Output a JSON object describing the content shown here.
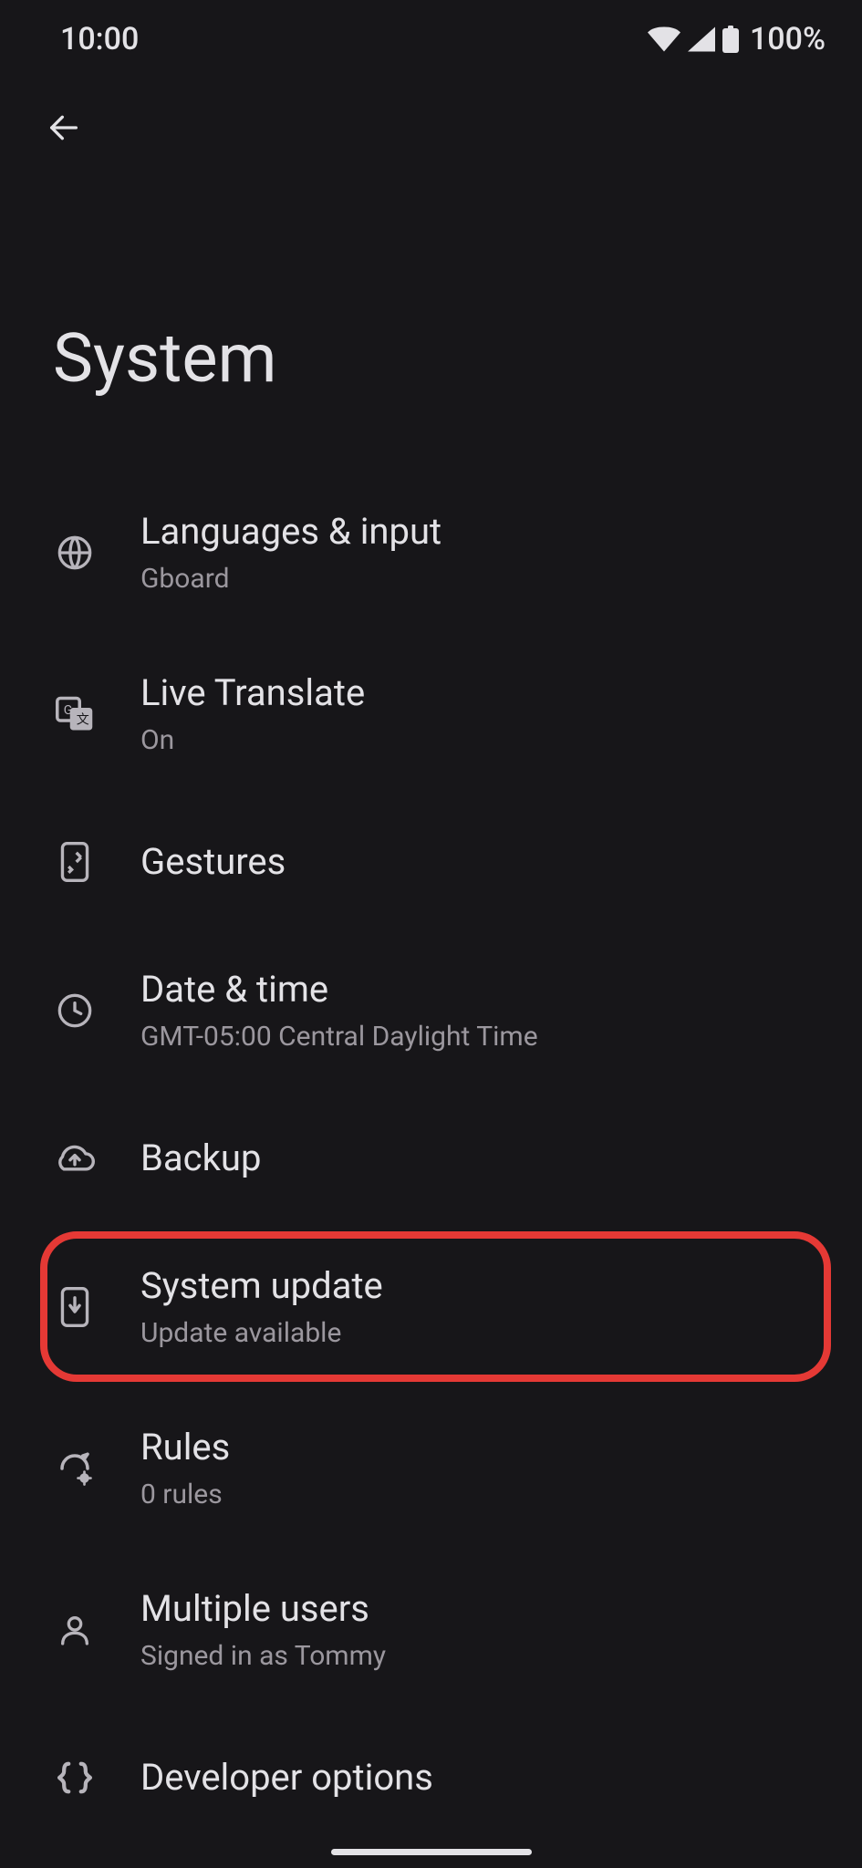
{
  "status": {
    "time": "10:00",
    "battery": "100%"
  },
  "page": {
    "title": "System"
  },
  "items": [
    {
      "icon": "globe",
      "title": "Languages & input",
      "subtitle": "Gboard"
    },
    {
      "icon": "translate",
      "title": "Live Translate",
      "subtitle": "On"
    },
    {
      "icon": "gestures",
      "title": "Gestures",
      "subtitle": ""
    },
    {
      "icon": "clock",
      "title": "Date & time",
      "subtitle": "GMT-05:00 Central Daylight Time"
    },
    {
      "icon": "cloud-upload",
      "title": "Backup",
      "subtitle": ""
    },
    {
      "icon": "phone-download",
      "title": "System update",
      "subtitle": "Update available",
      "highlighted": true
    },
    {
      "icon": "rules",
      "title": "Rules",
      "subtitle": "0 rules"
    },
    {
      "icon": "person",
      "title": "Multiple users",
      "subtitle": "Signed in as Tommy"
    },
    {
      "icon": "braces",
      "title": "Developer options",
      "subtitle": ""
    }
  ]
}
